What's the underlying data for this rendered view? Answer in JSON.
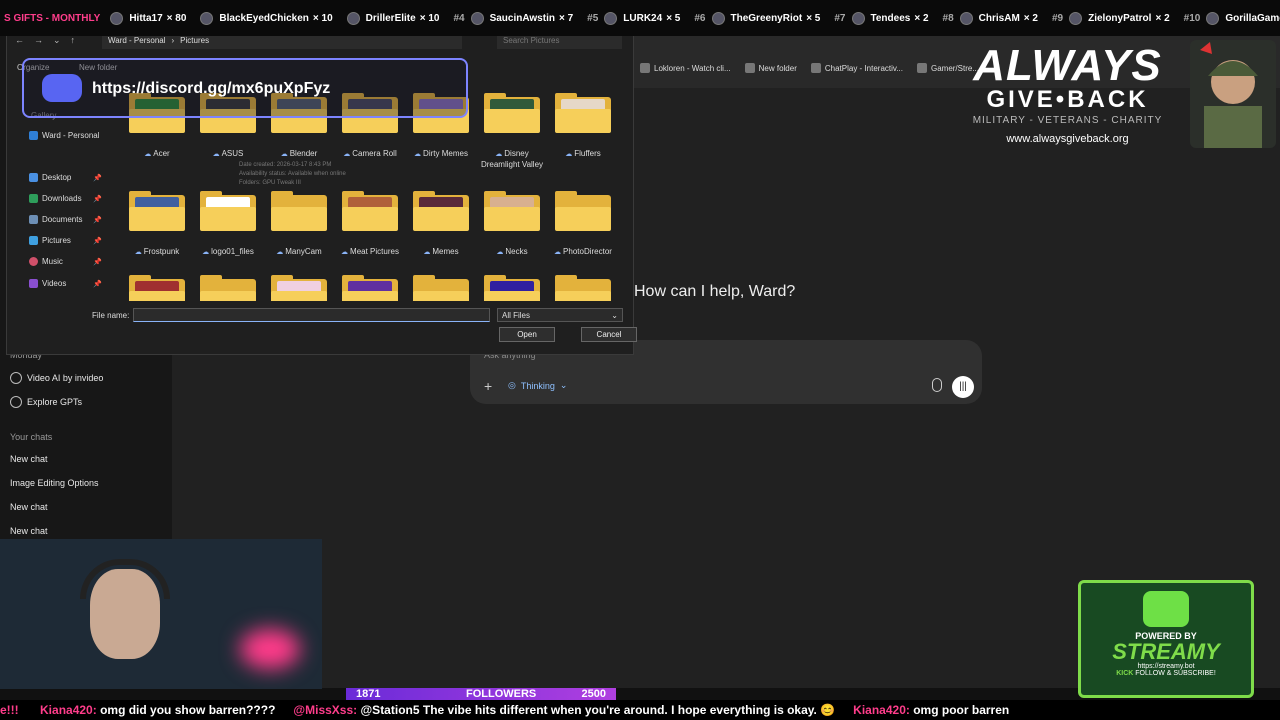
{
  "ticker": {
    "lead": "S GIFTS - MONTHLY",
    "entries": [
      {
        "rank": "",
        "name": "Hitta17",
        "count": "× 80"
      },
      {
        "rank": "",
        "name": "BlackEyedChicken",
        "count": "× 10"
      },
      {
        "rank": "",
        "name": "DrillerElite",
        "count": "× 10"
      },
      {
        "rank": "#4",
        "name": "SaucinAwstin",
        "count": "× 7"
      },
      {
        "rank": "#5",
        "name": "LURK24",
        "count": "× 5"
      },
      {
        "rank": "#6",
        "name": "TheGreenyRiot",
        "count": "× 5"
      },
      {
        "rank": "#7",
        "name": "Tendees",
        "count": "× 2"
      },
      {
        "rank": "#8",
        "name": "ChrisAM",
        "count": "× 2"
      },
      {
        "rank": "#9",
        "name": "ZielonyPatrol",
        "count": "× 2"
      },
      {
        "rank": "#10",
        "name": "GorillaGame",
        "count": ""
      }
    ]
  },
  "sidebar": {
    "day": "Monday",
    "items": [
      "Video AI by invideo",
      "Explore GPTs"
    ],
    "your_chats": "Your chats",
    "chats": [
      "New chat",
      "Image Editing Options",
      "New chat",
      "New chat"
    ]
  },
  "browser": {
    "tabs": [
      "Lokloren - Watch cli...",
      "New folder",
      "ChatPlay - Interactiv...",
      "Gamer/Stre..."
    ]
  },
  "logo": {
    "line1": "ALWAYS",
    "line2": "GIVE•BACK",
    "line3": "MILITARY - VETERANS - CHARITY",
    "line4": "www.alwaysgiveback.org"
  },
  "assistant": {
    "greeting": "How can I help, Ward?",
    "placeholder": "Ask anything",
    "thinking": "Thinking"
  },
  "dialog": {
    "path": [
      "Ward - Personal",
      "Pictures"
    ],
    "search_placeholder": "Search Pictures",
    "organize": "Organize",
    "new_folder": "New folder",
    "nav": [
      {
        "label": "Gallery",
        "pinned": false
      },
      {
        "label": "Ward - Personal",
        "pinned": false
      },
      {
        "label": "Desktop",
        "pinned": true
      },
      {
        "label": "Downloads",
        "pinned": true
      },
      {
        "label": "Documents",
        "pinned": true
      },
      {
        "label": "Pictures",
        "pinned": true
      },
      {
        "label": "Music",
        "pinned": true
      },
      {
        "label": "Videos",
        "pinned": true
      }
    ],
    "folders": [
      {
        "label": "Acer",
        "thumb": "#2f8a3a"
      },
      {
        "label": "ASUS",
        "thumb": "#3a3a3a"
      },
      {
        "label": "Blender",
        "thumb": "#556070"
      },
      {
        "label": "Camera Roll",
        "thumb": "#4a4a60"
      },
      {
        "label": "Dirty Memes",
        "thumb": "#8a70c0"
      },
      {
        "label": "Disney Dreamlight Valley",
        "thumb": "#305a3a"
      },
      {
        "label": "Fluffers",
        "thumb": "#e6d8c8"
      },
      {
        "label": "Frostpunk",
        "thumb": "#4060a0"
      },
      {
        "label": "logo01_files",
        "thumb": "#ffffff"
      },
      {
        "label": "ManyCam",
        "thumb": ""
      },
      {
        "label": "Meat Pictures",
        "thumb": "#b0603a"
      },
      {
        "label": "Memes",
        "thumb": "#5a2a3a"
      },
      {
        "label": "Necks",
        "thumb": "#d8b090"
      },
      {
        "label": "PhotoDirector",
        "thumb": ""
      },
      {
        "label": "",
        "thumb": "#a03030"
      },
      {
        "label": "",
        "thumb": ""
      },
      {
        "label": "",
        "thumb": "#f0d0e0"
      },
      {
        "label": "",
        "thumb": "#6030a0"
      },
      {
        "label": "",
        "thumb": ""
      },
      {
        "label": "",
        "thumb": "#3020a0"
      },
      {
        "label": "",
        "thumb": ""
      }
    ],
    "tooltip": [
      "Date created: 2026-03-17 8:43 PM",
      "Availability status: Available when online",
      "Folders: GPU Tweak III"
    ],
    "file_name_label": "File name:",
    "file_name_value": "",
    "file_type": "All Files",
    "open": "Open",
    "cancel": "Cancel"
  },
  "discord": {
    "url": "https://discord.gg/mx6puXpFyz"
  },
  "streamy": {
    "line1": "POWERED BY",
    "line2": "STREAMY",
    "line3": "https://streamy.bot",
    "kick": "KICK",
    "line4": "FOLLOW & SUBSCRIBE!"
  },
  "followers": {
    "current": "1871",
    "label": "FOLLOWERS",
    "goal": "2500"
  },
  "chat": [
    {
      "user": "e!!!",
      "text": ""
    },
    {
      "user": "Kiana420:",
      "text": "omg did you show barren????"
    },
    {
      "user": "@MissXss:",
      "text": "@Station5 The vibe hits different when you're around. I hope everything is okay. 😊"
    },
    {
      "user": "Kiana420:",
      "text": "omg poor barren"
    }
  ],
  "colors": {
    "accent": "#ff3d8b",
    "discord": "#5865f2",
    "folder": "#e3b23c",
    "streamy": "#7fdc4a"
  }
}
